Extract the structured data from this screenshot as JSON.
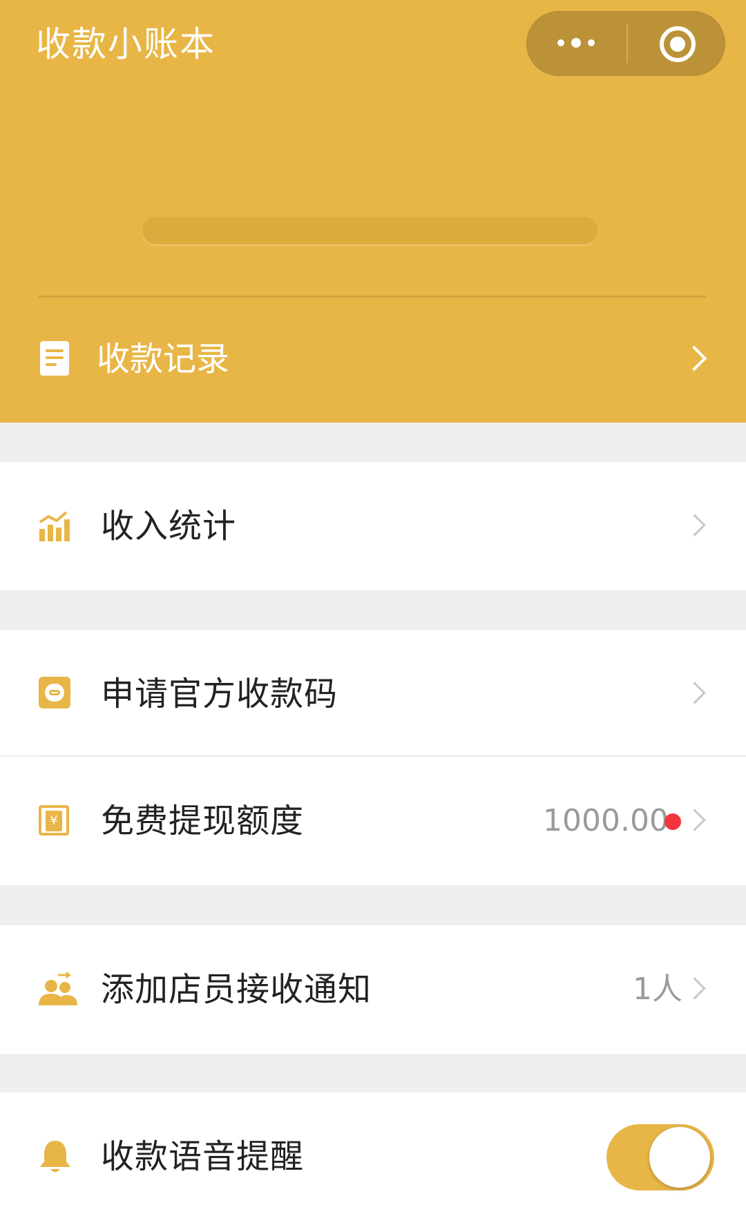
{
  "header": {
    "title": "收款小账本",
    "record_label": "收款记录",
    "accent": "#e8b647"
  },
  "capsule": {
    "more_icon": "more-dots-icon",
    "close_icon": "miniprogram-close-icon"
  },
  "menu": {
    "income_stats": {
      "label": "收入统计",
      "icon": "bar-chart-icon"
    },
    "apply_code": {
      "label": "申请官方收款码",
      "icon": "qr-code-icon"
    },
    "free_withdraw": {
      "label": "免费提现额度",
      "value": "1000.00",
      "icon": "wallet-yuan-icon",
      "badge_color": "#f2353f"
    },
    "add_staff": {
      "label": "添加店员接收通知",
      "value": "1人",
      "icon": "people-icon"
    },
    "voice_alert": {
      "label": "收款语音提醒",
      "icon": "bell-icon",
      "enabled": true
    }
  }
}
